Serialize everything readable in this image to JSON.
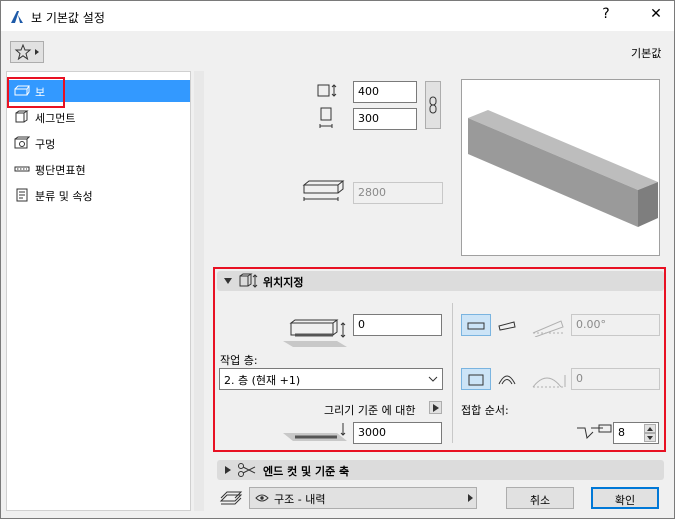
{
  "window": {
    "title": "보 기본값 설정",
    "help": "?",
    "close": "✕"
  },
  "header": {
    "right_label": "기본값"
  },
  "sidebar": {
    "items": [
      {
        "label": "보",
        "icon": "beam-icon",
        "selected": true
      },
      {
        "label": "세그먼트",
        "icon": "segment-icon",
        "selected": false
      },
      {
        "label": "구멍",
        "icon": "hole-icon",
        "selected": false
      },
      {
        "label": "평단면표현",
        "icon": "plan-section-icon",
        "selected": false
      },
      {
        "label": "분류 및 속성",
        "icon": "classification-icon",
        "selected": false
      }
    ]
  },
  "geometry": {
    "width_value": "400",
    "height_value": "300",
    "length_value": "2800"
  },
  "positioning": {
    "section_title": "위치지정",
    "offset_value": "0",
    "work_layer_label": "작업 층:",
    "work_layer_value": "2. 층 (현재 +1)",
    "reference_label": "그리기 기준 에 대한",
    "reference_value": "3000",
    "slant_angle_value": "0.00°",
    "curve_value": "0",
    "junction_order_label": "접합 순서:",
    "junction_order_value": "8"
  },
  "section2": {
    "title": "엔드 컷 및 기준 축"
  },
  "footer": {
    "layer_value": "구조 - 내력",
    "cancel_label": "취소",
    "ok_label": "확인"
  },
  "colors": {
    "selection": "#3399ff",
    "highlight_border": "#e81123",
    "accent": "#0078d7"
  }
}
